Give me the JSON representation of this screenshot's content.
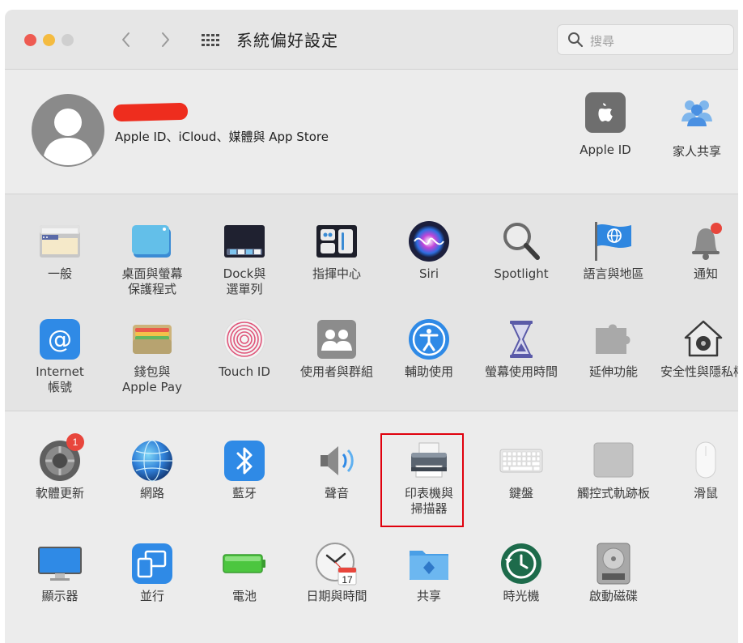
{
  "window": {
    "title": "系統偏好設定",
    "search_placeholder": "搜尋"
  },
  "account": {
    "subtitle": "Apple ID、iCloud、媒體與 App Store",
    "links": [
      {
        "label": "Apple ID",
        "icon": "apple-logo-icon"
      },
      {
        "label": "家人共享",
        "icon": "family-sharing-icon"
      }
    ]
  },
  "sections": [
    {
      "rows": [
        [
          {
            "label": "一般",
            "icon": "general-icon"
          },
          {
            "label": "桌面與螢幕\n保護程式",
            "icon": "desktop-screensaver-icon"
          },
          {
            "label": "Dock與\n選單列",
            "icon": "dock-icon"
          },
          {
            "label": "指揮中心",
            "icon": "control-center-icon"
          },
          {
            "label": "Siri",
            "icon": "siri-icon"
          },
          {
            "label": "Spotlight",
            "icon": "spotlight-icon"
          },
          {
            "label": "語言與地區",
            "icon": "language-region-icon"
          },
          {
            "label": "通知",
            "icon": "notifications-icon"
          }
        ],
        [
          {
            "label": "Internet\n帳號",
            "icon": "internet-accounts-icon"
          },
          {
            "label": "錢包與\nApple Pay",
            "icon": "wallet-icon"
          },
          {
            "label": "Touch ID",
            "icon": "touch-id-icon"
          },
          {
            "label": "使用者與群組",
            "icon": "users-groups-icon"
          },
          {
            "label": "輔助使用",
            "icon": "accessibility-icon"
          },
          {
            "label": "螢幕使用時間",
            "icon": "screen-time-icon"
          },
          {
            "label": "延伸功能",
            "icon": "extensions-icon"
          },
          {
            "label": "安全性與隱私權",
            "icon": "security-privacy-icon"
          }
        ]
      ]
    },
    {
      "rows": [
        [
          {
            "label": "軟體更新",
            "icon": "software-update-icon",
            "badge": "1"
          },
          {
            "label": "網路",
            "icon": "network-icon"
          },
          {
            "label": "藍牙",
            "icon": "bluetooth-icon"
          },
          {
            "label": "聲音",
            "icon": "sound-icon"
          },
          {
            "label": "印表機與\n掃描器",
            "icon": "printer-icon",
            "highlighted": true
          },
          {
            "label": "鍵盤",
            "icon": "keyboard-icon"
          },
          {
            "label": "觸控式軌跡板",
            "icon": "trackpad-icon"
          },
          {
            "label": "滑鼠",
            "icon": "mouse-icon"
          }
        ],
        [
          {
            "label": "顯示器",
            "icon": "displays-icon"
          },
          {
            "label": "並行",
            "icon": "sidecar-icon"
          },
          {
            "label": "電池",
            "icon": "battery-icon"
          },
          {
            "label": "日期與時間",
            "icon": "date-time-icon",
            "icon_text": "17"
          },
          {
            "label": "共享",
            "icon": "sharing-icon"
          },
          {
            "label": "時光機",
            "icon": "time-machine-icon"
          },
          {
            "label": "啟動磁碟",
            "icon": "startup-disk-icon"
          }
        ]
      ]
    }
  ],
  "colors": {
    "highlight_box": "#e0000d",
    "badge": "#e8463c",
    "redaction": "#ee2d1e"
  }
}
